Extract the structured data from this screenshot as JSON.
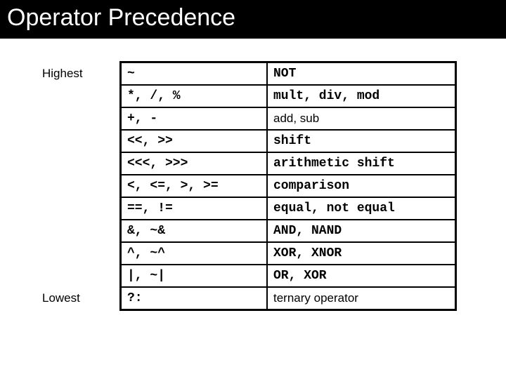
{
  "title": "Operator Precedence",
  "labels": {
    "highest": "Highest",
    "lowest": "Lowest"
  },
  "rows": [
    {
      "ops": "~",
      "desc": "NOT",
      "desc_sans": false
    },
    {
      "ops": "*, /, %",
      "desc": "mult, div, mod",
      "desc_sans": false
    },
    {
      "ops": "+, -",
      "desc": "add, sub",
      "desc_sans": true
    },
    {
      "ops": "<<, >>",
      "desc": "shift",
      "desc_sans": false
    },
    {
      "ops": "<<<, >>>",
      "desc": "arithmetic shift",
      "desc_sans": false
    },
    {
      "ops": "<, <=, >, >=",
      "desc": "comparison",
      "desc_sans": false
    },
    {
      "ops": "==, !=",
      "desc": "equal, not equal",
      "desc_sans": false
    },
    {
      "ops": "&, ~&",
      "desc": "AND, NAND",
      "desc_sans": false
    },
    {
      "ops": "^, ~^",
      "desc": "XOR, XNOR",
      "desc_sans": false
    },
    {
      "ops": "|, ~|",
      "desc": "OR, XOR",
      "desc_sans": false
    },
    {
      "ops": "?:",
      "desc": "ternary operator",
      "desc_sans": true
    }
  ]
}
